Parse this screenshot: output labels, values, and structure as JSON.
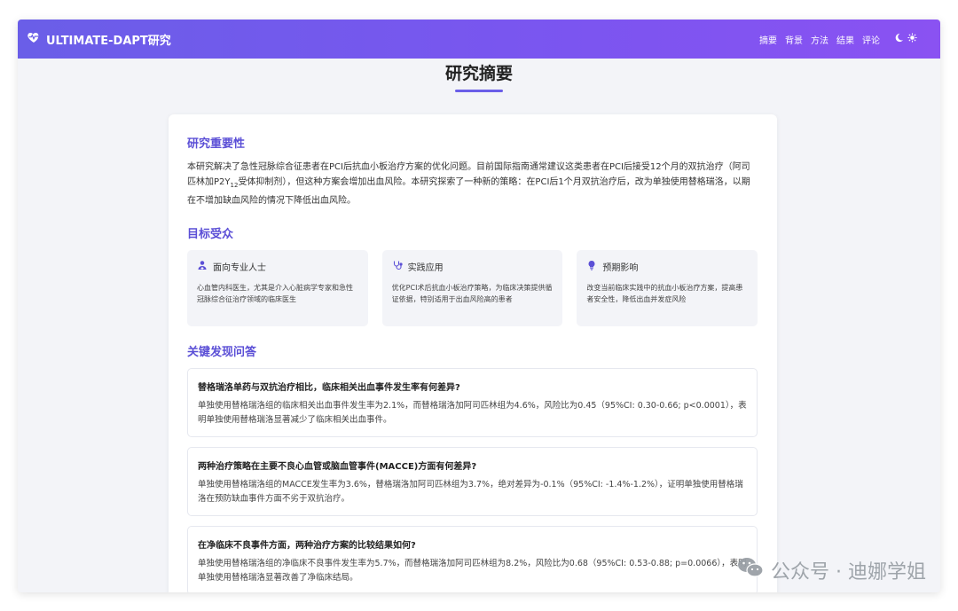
{
  "navbar": {
    "brand": "ULTIMATE-DAPT研究",
    "links": [
      "摘要",
      "背景",
      "方法",
      "结果",
      "评论"
    ]
  },
  "page": {
    "title": "研究摘要"
  },
  "importance": {
    "heading": "研究重要性",
    "text_a": "本研究解决了急性冠脉综合征患者在PCI后抗血小板治疗方案的优化问题。目前国际指南通常建议这类患者在PCI后接受12个月的双抗治疗（阿司匹林加P2Y",
    "text_sub": "12",
    "text_b": "受体抑制剂），但这种方案会增加出血风险。本研究探索了一种新的策略：在PCI后1个月双抗治疗后，改为单独使用替格瑞洛，以期在不增加缺血风险的情况下降低出血风险。"
  },
  "audience": {
    "heading": "目标受众",
    "cards": [
      {
        "icon": "doctor-icon",
        "title": "面向专业人士",
        "text": "心血管内科医生，尤其是介入心脏病学专家和急性冠脉综合征治疗领域的临床医生"
      },
      {
        "icon": "stethoscope-icon",
        "title": "实践应用",
        "text": "优化PCI术后抗血小板治疗策略，为临床决策提供循证依据，特别适用于出血风险高的患者"
      },
      {
        "icon": "lightbulb-icon",
        "title": "预期影响",
        "text": "改变当前临床实践中的抗血小板治疗方案，提高患者安全性，降低出血并发症风险"
      }
    ]
  },
  "findings": {
    "heading": "关键发现问答",
    "items": [
      {
        "q": "替格瑞洛单药与双抗治疗相比，临床相关出血事件发生率有何差异?",
        "a": "单独使用替格瑞洛组的临床相关出血事件发生率为2.1%，而替格瑞洛加阿司匹林组为4.6%，风险比为0.45（95%CI: 0.30-0.66; p<0.0001），表明单独使用替格瑞洛显著减少了临床相关出血事件。"
      },
      {
        "q": "两种治疗策略在主要不良心血管或脑血管事件(MACCE)方面有何差异?",
        "a": "单独使用替格瑞洛组的MACCE发生率为3.6%，替格瑞洛加阿司匹林组为3.7%，绝对差异为-0.1%（95%CI: -1.4%-1.2%），证明单独使用替格瑞洛在预防缺血事件方面不劣于双抗治疗。"
      },
      {
        "q": "在净临床不良事件方面，两种治疗方案的比较结果如何?",
        "a": "单独使用替格瑞洛组的净临床不良事件发生率为5.7%，而替格瑞洛加阿司匹林组为8.2%，风险比为0.68（95%CI: 0.53-0.88; p=0.0066），表明单独使用替格瑞洛显著改善了净临床结局。"
      }
    ]
  },
  "watermark": {
    "text": "公众号 · 迪娜学姐"
  },
  "colors": {
    "accent": "#6a5ee8",
    "heading": "#5b4fd6",
    "background": "#f3f4f8"
  }
}
